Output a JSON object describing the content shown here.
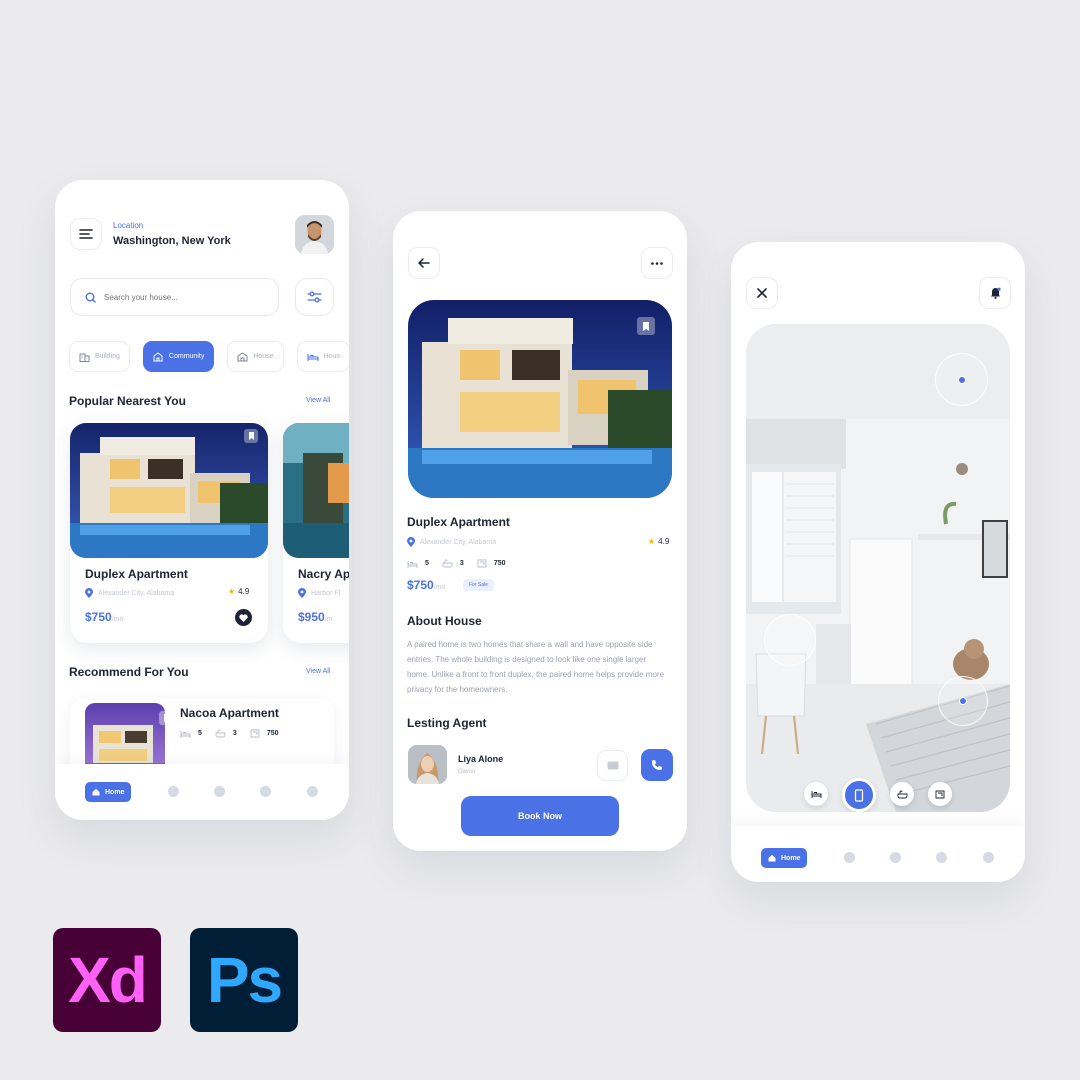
{
  "screen1": {
    "location_label": "Location",
    "location_value": "Washington, New York",
    "search_placeholder": "Search your house...",
    "categories": [
      {
        "label": "Building",
        "icon": "building-icon",
        "active": false
      },
      {
        "label": "Community",
        "icon": "community-icon",
        "active": true
      },
      {
        "label": "House",
        "icon": "house-icon",
        "active": false
      },
      {
        "label": "Hous",
        "icon": "bed-icon",
        "active": false
      }
    ],
    "popular_title": "Popular Nearest You",
    "popular_view_all": "View All",
    "cards": [
      {
        "title": "Duplex Apartment",
        "address": "Alexander City, Alabama",
        "rating": "4.9",
        "price": "$750",
        "period": "/mo"
      },
      {
        "title": "Nacry Ap",
        "address": "Harbor Fl",
        "rating": "",
        "price": "$950",
        "period": "/m"
      }
    ],
    "recommend_title": "Recommend For You",
    "recommend_view_all": "View All",
    "recommend_item": {
      "title": "Nacoa Apartment",
      "beds": "5",
      "baths": "3",
      "area": "750"
    },
    "nav_home_label": "Home"
  },
  "screen2": {
    "title": "Duplex Apartment",
    "address": "Alexander City, Alabama",
    "rating": "4.9",
    "beds": "5",
    "baths": "3",
    "area": "750",
    "price": "$750",
    "period": "/mo",
    "badge": "For Sale",
    "about_title": "About House",
    "about_text": "A paired home is two homes that share a wall and have opposite side entries. The whole building is designed to look like one single larger home. Unlike a front to front duplex, the paired home helps provide more privacy for the homeowners.",
    "agent_title": "Lesting Agent",
    "agent_name": "Liya Alone",
    "agent_role": "Owner",
    "book_label": "Book Now"
  },
  "screen3": {
    "nav_home_label": "Home"
  },
  "logos": {
    "xd": "Xd",
    "ps": "Ps"
  },
  "colors": {
    "accent": "#4a72e6",
    "dark": "#1d2433",
    "background": "#ebebed",
    "star": "#f5b400"
  }
}
